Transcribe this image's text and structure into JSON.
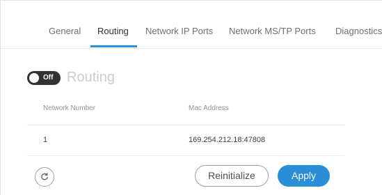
{
  "tabs": [
    {
      "label": "General"
    },
    {
      "label": "Routing",
      "active": true
    },
    {
      "label": "Network IP Ports"
    },
    {
      "label": "Network MS/TP Ports"
    },
    {
      "label": "Diagnostics"
    }
  ],
  "routing": {
    "toggle_state": "Off",
    "title": "Routing"
  },
  "table": {
    "columns": [
      "Network Number",
      "Mac Address"
    ],
    "rows": [
      [
        "1",
        "169.254.212.18:47808"
      ]
    ]
  },
  "actions": {
    "refresh_icon": "refresh-icon",
    "reinitialize_label": "Reinitialize",
    "apply_label": "Apply"
  },
  "colors": {
    "accent": "#2a8fd6",
    "toggle_off_bg": "#2f3338"
  }
}
